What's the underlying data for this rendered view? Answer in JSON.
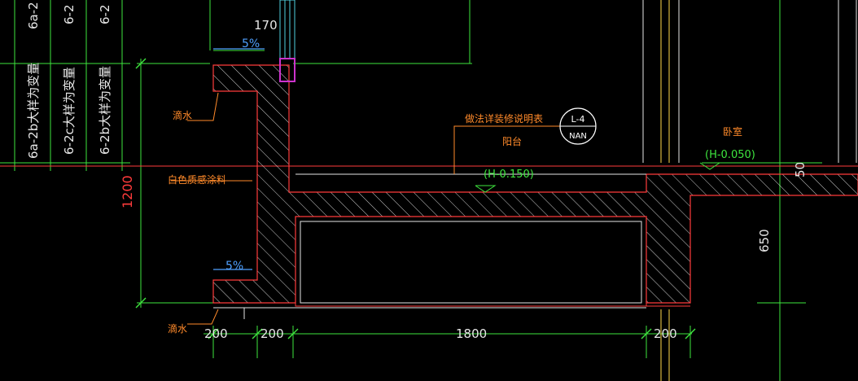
{
  "drawing": {
    "left_column_labels": [
      "6a-2b大样为变量",
      "6-2c大样为变量",
      "6-2b大样为变量"
    ],
    "top_column_labels": [
      "6a-2",
      "6-2",
      "6-2"
    ],
    "dimensions": {
      "top_170": "170",
      "left_1200": "1200",
      "right_50": "50",
      "right_650": "650",
      "bottom": [
        "200",
        "200",
        "1800",
        "200"
      ]
    },
    "slopes": [
      "5%",
      "5%"
    ],
    "notes": {
      "drip_top": "滴水",
      "drip_bottom": "滴水",
      "white_paint": "白色质感涂料",
      "finish_ref": "做法详装修说明表",
      "balcony": "阳台",
      "bedroom": "卧室"
    },
    "levels": {
      "balcony": "(H-0.150)",
      "bedroom": "(H-0.050)"
    },
    "detail_marker": {
      "number": "L-4",
      "ref": "NAN"
    },
    "colors": {
      "background": "#000000",
      "hatch": "#ffffff",
      "outline": "#ff3b3b",
      "dimension_line": "#3ee63e",
      "note": "#ff8a2a",
      "text": "#e6e6e6",
      "window": "#cc33cc",
      "window_frame": "#4fd2e0",
      "column_line": "#ffd84a"
    }
  }
}
